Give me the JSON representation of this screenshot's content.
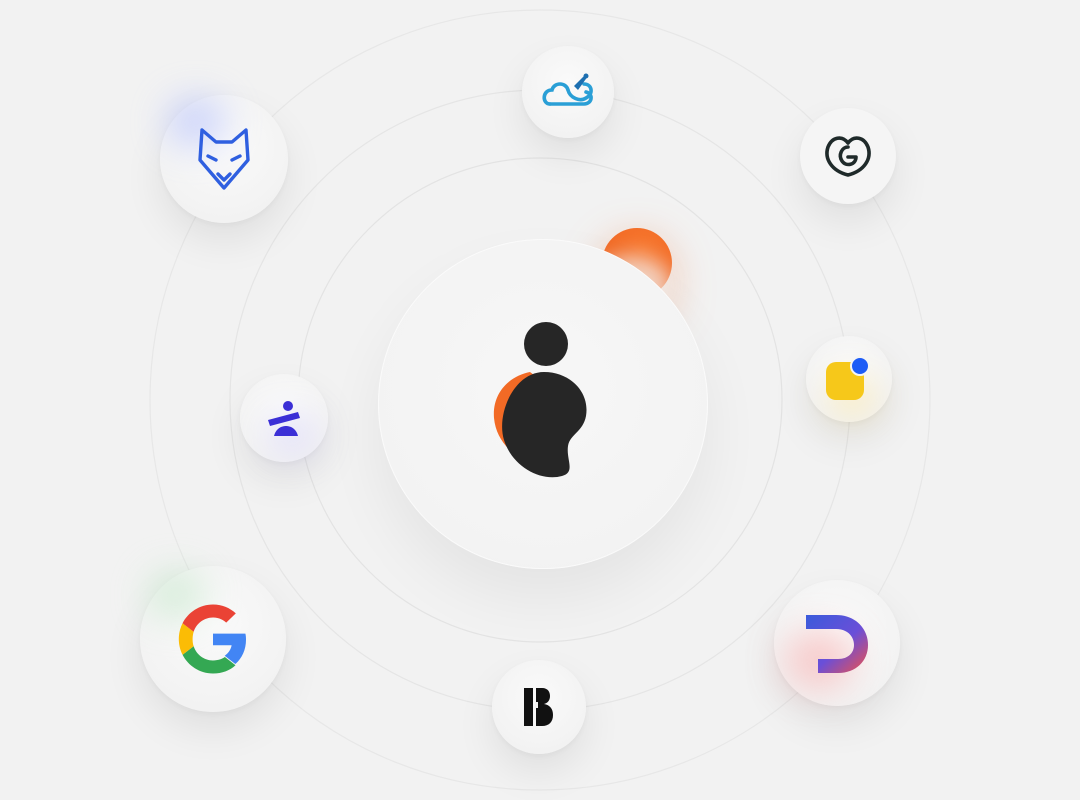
{
  "center_logo": {
    "icon": "brand-person-icon",
    "colors": {
      "dark": "#262626",
      "accent": "#f26a25"
    }
  },
  "integrations": [
    {
      "name_key": "wolf",
      "icon": "wolf-head-icon",
      "color": "#2f5fe0"
    },
    {
      "name_key": "cloud-rocket",
      "icon": "cloud-rocket-icon",
      "color": "#2a9fd6"
    },
    {
      "name_key": "godaddy",
      "icon": "godaddy-heart-icon",
      "color": "#1f2a2a"
    },
    {
      "name_key": "yellow-square",
      "icon": "yellow-square-dot-icon",
      "color": "#f6c81a"
    },
    {
      "name_key": "d-mark",
      "icon": "d-gradient-icon",
      "color": "#3b5bdb"
    },
    {
      "name_key": "b-mark",
      "icon": "b-letter-icon",
      "color": "#111111"
    },
    {
      "name_key": "google",
      "icon": "google-g-icon",
      "color": "#4285f4"
    },
    {
      "name_key": "balance",
      "icon": "balance-figure-icon",
      "color": "#3b2fd6"
    }
  ],
  "decor": {
    "orb_color": "#f26a25"
  }
}
